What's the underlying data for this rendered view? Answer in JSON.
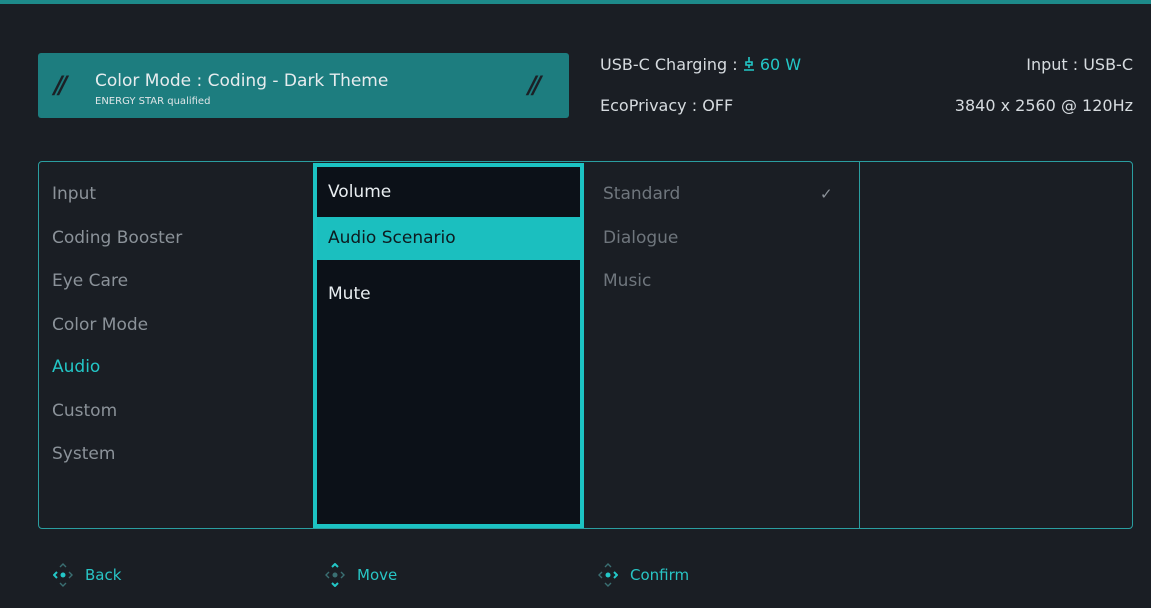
{
  "colors": {
    "accent": "#1cc3c3",
    "panel": "#1d7d7f",
    "background": "#1a1e24"
  },
  "mode_panel": {
    "title": "Color Mode : Coding - Dark Theme",
    "subtitle": "ENERGY STAR qualified"
  },
  "status": {
    "charging_label": "USB-C Charging :",
    "charging_icon": "charging-icon",
    "charging_value": "60 W",
    "ecoprivacy": "EcoPrivacy : OFF",
    "input": "Input : USB-C",
    "resolution": "3840 x 2560 @ 120Hz"
  },
  "categories": [
    "Input",
    "Coding Booster",
    "Eye Care",
    "Color Mode",
    "Audio",
    "Custom",
    "System"
  ],
  "active_category": "Audio",
  "submenu": [
    "Volume",
    "Audio Scenario",
    "Mute"
  ],
  "selected_submenu": "Audio Scenario",
  "options": [
    "Standard",
    "Dialogue",
    "Music"
  ],
  "checked_option": "Standard",
  "nav": {
    "back": "Back",
    "move": "Move",
    "confirm": "Confirm"
  }
}
